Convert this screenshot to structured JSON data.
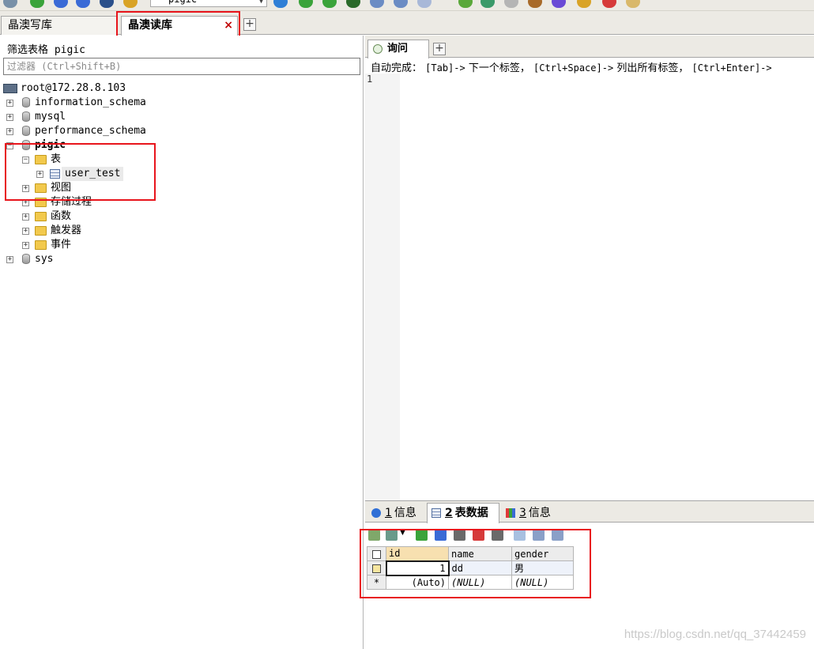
{
  "toolbar": {
    "database_select": "pigic",
    "icons": [
      "plug-icon",
      "new-db-icon",
      "db-icon",
      "db-icon",
      "refresh-icon",
      "grid-icon",
      "run-icon",
      "execute-icon",
      "stop-icon",
      "schema-icon",
      "table-icon",
      "grid-icon",
      "check-icon",
      "history-icon",
      "backup-icon",
      "truck-icon",
      "sync-icon",
      "key-icon",
      "report-icon",
      "export-icon"
    ]
  },
  "connection_tabs": [
    {
      "label": "晶澳写库",
      "active": false
    },
    {
      "label": "晶澳读库",
      "active": true,
      "close_glyph": "×"
    }
  ],
  "left_panel": {
    "filter_label": "筛选表格 pigic",
    "filter_placeholder": "过滤器 (Ctrl+Shift+B)",
    "tree": {
      "root": "root@172.28.8.103",
      "databases": [
        "information_schema",
        "mysql",
        "performance_schema",
        "pigic",
        "sys"
      ],
      "expanded_db": "pigic",
      "pigic_children": [
        "表",
        "视图",
        "存储过程",
        "函数",
        "触发器",
        "事件"
      ],
      "tables": [
        "user_test"
      ]
    }
  },
  "query_panel": {
    "tab_label": "询问",
    "hint": {
      "prefix": "自动完成：",
      "k1": "[Tab]->",
      "d1": "下一个标签，",
      "k2": "[Ctrl+Space]->",
      "d2": "列出所有标签，",
      "k3": "[Ctrl+Enter]->"
    },
    "line_numbers": [
      "1"
    ]
  },
  "result_tabs": [
    {
      "num": "1",
      "label": "信息",
      "icon": "info-icon",
      "active": false
    },
    {
      "num": "2",
      "label": "表数据",
      "icon": "table-data-icon",
      "active": true
    },
    {
      "num": "3",
      "label": "信息",
      "icon": "profiler-icon",
      "active": false
    }
  ],
  "result_grid": {
    "columns": [
      "id",
      "name",
      "gender"
    ],
    "rows": [
      {
        "id": "1",
        "name": "dd",
        "gender": "男"
      }
    ],
    "new_row": {
      "marker": "*",
      "id": "(Auto)",
      "name": "(NULL)",
      "gender": "(NULL)"
    }
  },
  "colors": {
    "highlight_box": "#e8151c",
    "id_header": "#f7e0b0"
  },
  "watermark": "https://blog.csdn.net/qq_37442459"
}
